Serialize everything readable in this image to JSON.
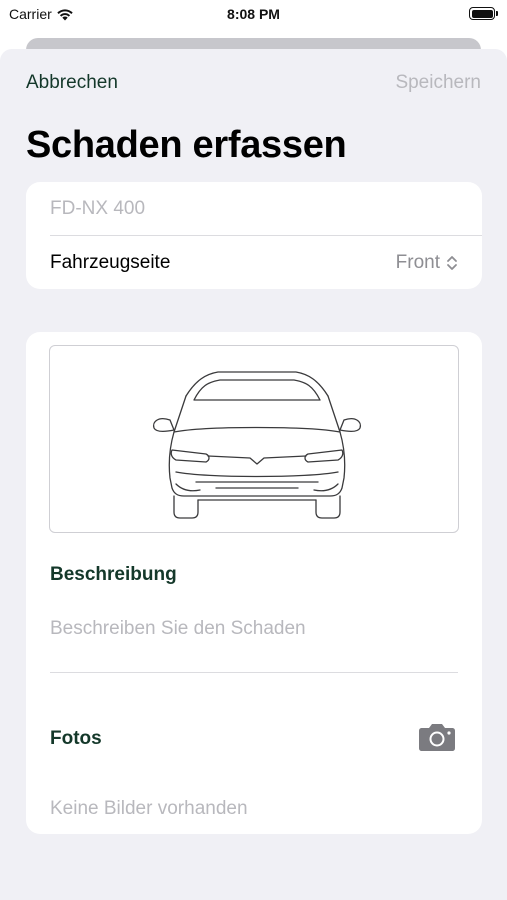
{
  "status_bar": {
    "carrier": "Carrier",
    "time": "8:08 PM"
  },
  "nav": {
    "cancel_label": "Abbrechen",
    "save_label": "Speichern"
  },
  "page_title": "Schaden erfassen",
  "vehicle": {
    "plate": "FD-NX 400",
    "side_label": "Fahrzeugseite",
    "side_value": "Front"
  },
  "description": {
    "label": "Beschreibung",
    "placeholder": "Beschreiben Sie den Schaden"
  },
  "photos": {
    "label": "Fotos",
    "empty_text": "Keine Bilder vorhanden"
  },
  "colors": {
    "accent": "#14382a",
    "sheet_background": "#f0f0f5",
    "placeholder": "#b8b8bd"
  }
}
